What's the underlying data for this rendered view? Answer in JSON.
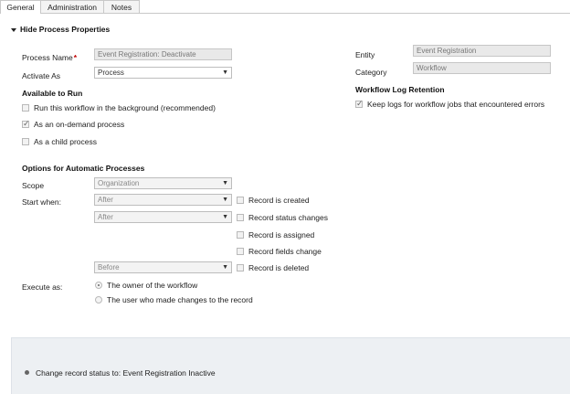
{
  "tabs": [
    {
      "label": "General",
      "active": true
    },
    {
      "label": "Administration",
      "active": false
    },
    {
      "label": "Notes",
      "active": false
    }
  ],
  "section": {
    "title": "Hide Process Properties",
    "toggle_icon": "collapse-triangle-icon"
  },
  "fields": {
    "process_name_label": "Process Name",
    "process_name_required": "*",
    "process_name_value": "Event Registration: Deactivate",
    "activate_as_label": "Activate As",
    "activate_as_value": "Process",
    "entity_label": "Entity",
    "entity_value": "Event Registration",
    "category_label": "Category",
    "category_value": "Workflow"
  },
  "available_to_run": {
    "title": "Available to Run",
    "options": [
      {
        "label": "Run this workflow in the background (recommended)",
        "checked": false
      },
      {
        "label": "As an on-demand process",
        "checked": true
      },
      {
        "label": "As a child process",
        "checked": false
      }
    ]
  },
  "log_retention": {
    "title": "Workflow Log Retention",
    "option_label": "Keep logs for workflow jobs that encountered errors",
    "checked": true
  },
  "automatic": {
    "title": "Options for Automatic Processes",
    "scope_label": "Scope",
    "scope_value": "Organization",
    "start_when_label": "Start when:",
    "start_rows": [
      {
        "select": "After",
        "checkbox_label": "Record is created"
      },
      {
        "select": "After",
        "checkbox_label": "Record status changes"
      },
      {
        "select": "",
        "checkbox_label": "Record is assigned"
      },
      {
        "select": "",
        "checkbox_label": "Record fields change"
      },
      {
        "select": "Before",
        "checkbox_label": "Record is deleted"
      }
    ],
    "execute_as_label": "Execute as:",
    "execute_options": [
      {
        "label": "The owner of the workflow",
        "selected": true
      },
      {
        "label": "The user who made changes to the record",
        "selected": false
      }
    ]
  },
  "steps": {
    "step_text": "Change record status to:  Event Registration  Inactive"
  }
}
